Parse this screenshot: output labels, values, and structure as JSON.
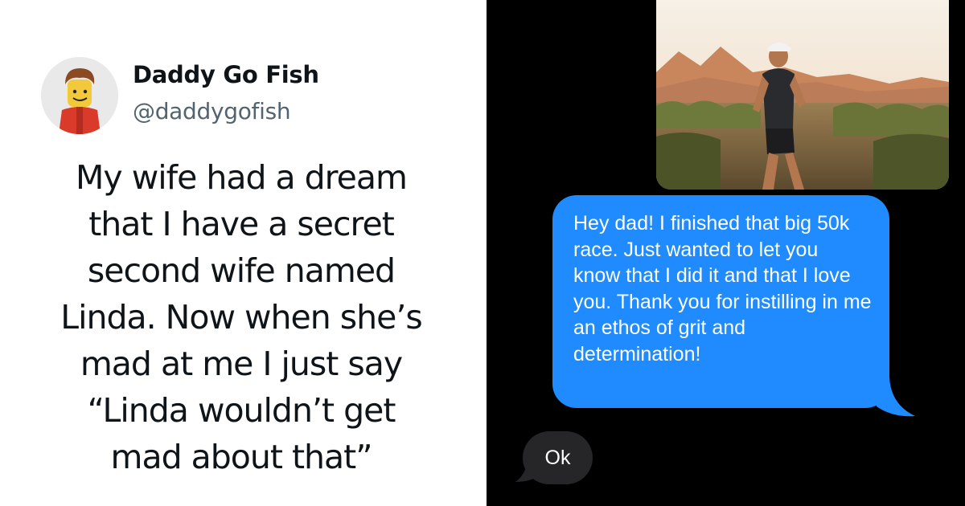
{
  "tweet": {
    "author_name": "Daddy Go Fish",
    "author_handle": "@daddygofish",
    "lines": [
      "My wife had a dream",
      "that I have a secret",
      "second wife named",
      "Linda. Now when she’s",
      "mad at me I just say",
      "“Linda wouldn’t get",
      "mad about that”"
    ]
  },
  "messages": {
    "photo_icon": "runner-photo",
    "outgoing_lines": [
      "Hey dad! I finished that big 50k",
      "race. Just wanted to let you",
      "know that I did it and that I love",
      "you. Thank you for instilling in me",
      "an ethos of grit and",
      "determination!"
    ],
    "incoming_reply": "Ok"
  },
  "colors": {
    "outgoing_bubble": "#1f8bfe",
    "incoming_bubble": "#262629",
    "messages_background": "#000000",
    "tweet_text": "#0f1419",
    "handle_text": "#536471"
  }
}
